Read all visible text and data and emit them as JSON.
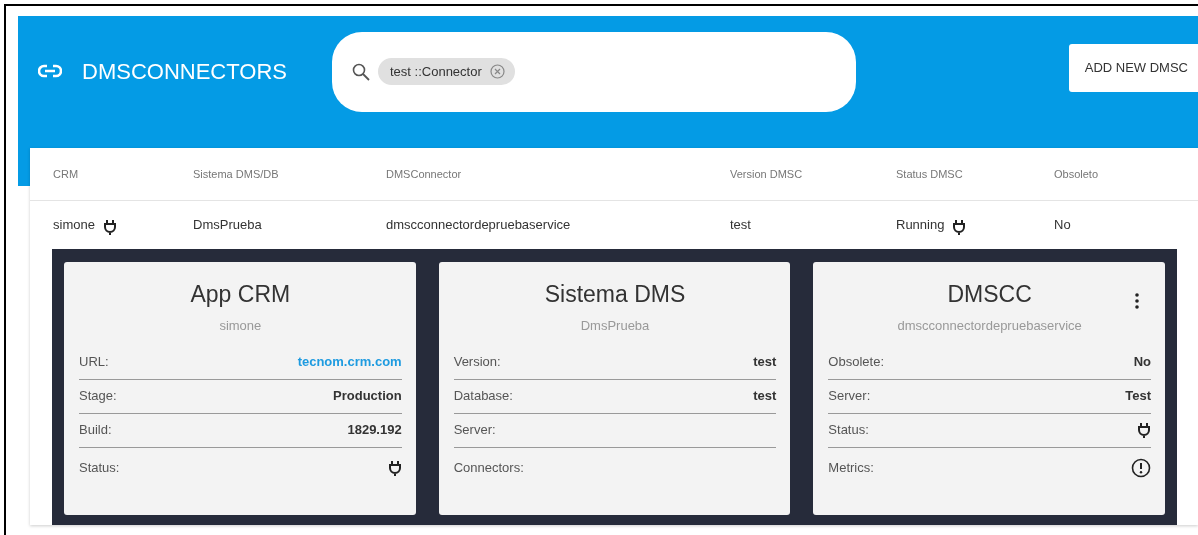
{
  "header": {
    "title": "DMSCONNECTORS",
    "search": {
      "chips": [
        {
          "label": "test ::Connector"
        }
      ]
    },
    "add_button": "ADD NEW DMSC"
  },
  "table": {
    "columns": [
      "CRM",
      "Sistema DMS/DB",
      "DMSConnector",
      "Version DMSC",
      "Status DMSC",
      "Obsoleto"
    ],
    "rows": [
      {
        "cells": [
          {
            "kind": "status",
            "text": "simone"
          },
          {
            "kind": "text",
            "text": "DmsPrueba"
          },
          {
            "kind": "text",
            "text": "dmscconnectordepruebaservice"
          },
          {
            "kind": "text",
            "text": "test"
          },
          {
            "kind": "status",
            "text": "Running"
          },
          {
            "kind": "text",
            "text": "No"
          }
        ],
        "expanded": true
      }
    ]
  },
  "cards": [
    {
      "title": "App CRM",
      "subtitle": "simone",
      "menu": false,
      "fields": [
        {
          "label": "URL:",
          "kind": "link",
          "value": "tecnom.crm.com"
        },
        {
          "label": "Stage:",
          "kind": "text",
          "value": "Production"
        },
        {
          "label": "Build:",
          "kind": "text",
          "value": "1829.192"
        },
        {
          "label": "Status:",
          "kind": "status"
        }
      ]
    },
    {
      "title": "Sistema DMS",
      "subtitle": "DmsPrueba",
      "menu": false,
      "fields": [
        {
          "label": "Version:",
          "kind": "text",
          "value": "test"
        },
        {
          "label": "Database:",
          "kind": "text",
          "value": "test"
        },
        {
          "label": "Server:",
          "kind": "text"
        },
        {
          "label": "Connectors:",
          "kind": "text"
        }
      ]
    },
    {
      "title": "DMSCC",
      "subtitle": "dmscconnectordepruebaservice",
      "menu": true,
      "fields": [
        {
          "label": "Obsolete:",
          "kind": "text",
          "value": "No"
        },
        {
          "label": "Server:",
          "kind": "text",
          "value": "Test"
        },
        {
          "label": "Status:",
          "kind": "status"
        },
        {
          "label": "Metrics:",
          "kind": "metrics"
        }
      ]
    }
  ]
}
